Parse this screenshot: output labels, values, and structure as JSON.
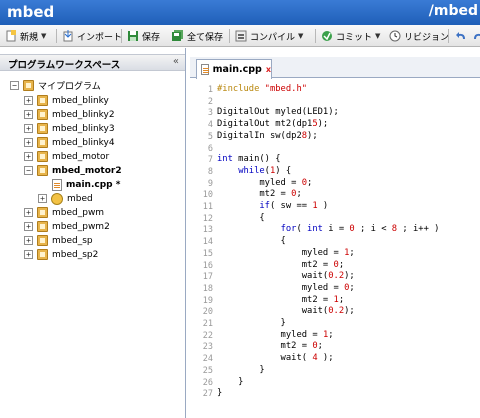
{
  "titlebar": {
    "app_name": "mbed",
    "path": "/mbed"
  },
  "toolbar": {
    "new_label": "新規",
    "import_label": "インポート",
    "save_label": "保存",
    "save_all_label": "全て保存",
    "compile_label": "コンパイル",
    "commit_label": "コミット",
    "revision_label": "リビジョン"
  },
  "workspace": {
    "title": "プログラムワークスペース",
    "collapse_glyph": "«",
    "root_label": "マイプログラム",
    "programs": [
      "mbed_blinky",
      "mbed_blinky2",
      "mbed_blinky3",
      "mbed_blinky4",
      "mbed_motor",
      "mbed_motor2",
      "main.cpp *",
      "mbed",
      "mbed_pwm",
      "mbed_pwm2",
      "mbed_sp",
      "mbed_sp2"
    ]
  },
  "editor": {
    "tab_name": "main.cpp",
    "tab_close": "x",
    "line_numbers": [
      "1",
      "2",
      "3",
      "4",
      "5",
      "6",
      "7",
      "8",
      "9",
      "10",
      "11",
      "12",
      "13",
      "14",
      "15",
      "16",
      "17",
      "18",
      "19",
      "20",
      "21",
      "22",
      "23",
      "24",
      "25",
      "26",
      "27"
    ],
    "lines": [
      "#include \"mbed.h\"",
      "",
      "DigitalOut myled(LED1);",
      "DigitalOut mt2(dp15);",
      "DigitalIn sw(dp28);",
      "",
      "int main() {",
      "    while(1) {",
      "        myled = 0;",
      "        mt2 = 0;",
      "        if( sw == 1 )",
      "        {",
      "            for( int i = 0 ; i < 8 ; i++ )",
      "            {",
      "                myled = 1;",
      "                mt2 = 0;",
      "                wait(0.2);",
      "                myled = 0;",
      "                mt2 = 1;",
      "                wait(0.2);",
      "            }",
      "            myled = 1;",
      "            mt2 = 0;",
      "            wait( 4 );",
      "        }",
      "    }",
      "}"
    ]
  }
}
